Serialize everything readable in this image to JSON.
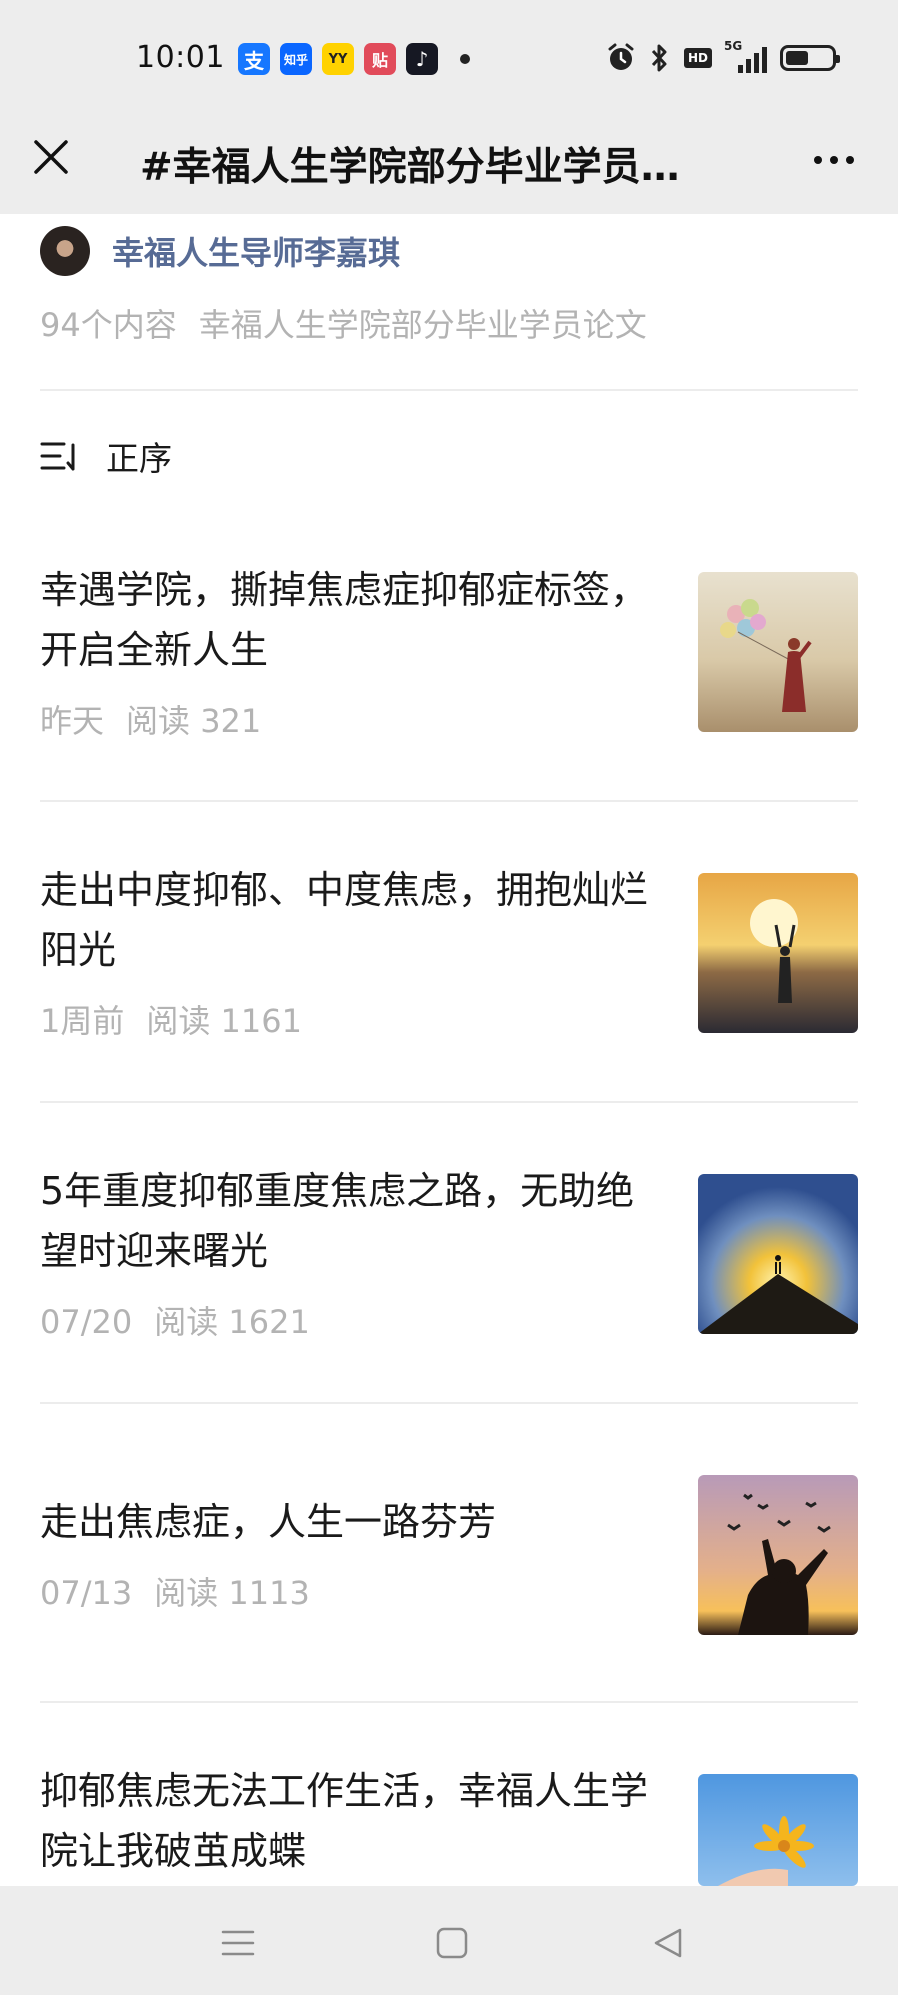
{
  "status_bar": {
    "time": "10:01",
    "notification_apps": [
      {
        "icon": "alipay-icon",
        "glyph": "支",
        "color": "#1677ff"
      },
      {
        "icon": "zhihu-icon",
        "glyph": "知乎",
        "color": "#0a66ff"
      },
      {
        "icon": "yy-icon",
        "glyph": "YY",
        "color": "#ffd200"
      },
      {
        "icon": "tieba-icon",
        "glyph": "贴",
        "color": "#e14b5a"
      },
      {
        "icon": "tiktok-icon",
        "glyph": "♪",
        "color": "#161823"
      }
    ],
    "system_icons": [
      "alarm-icon",
      "bluetooth-icon",
      "hd-icon",
      "5g-signal-icon",
      "battery-icon"
    ],
    "hd_label": "HD",
    "network_label": "5G",
    "battery_level": 0.45
  },
  "title_bar": {
    "title": "#幸福人生学院部分毕业学员…"
  },
  "album": {
    "author": "幸福人生导师李嘉琪",
    "count": "94个内容",
    "name": "幸福人生学院部分毕业学员论文"
  },
  "sort": {
    "label": "正序"
  },
  "articles": [
    {
      "title": "幸遇学院，撕掉焦虑症抑郁症标签，开启全新人生",
      "date": "昨天",
      "reads": "阅读 321",
      "thumbnail": "woman-with-balloons-image"
    },
    {
      "title": "走出中度抑郁、中度焦虑，拥抱灿烂阳光",
      "date": "1周前",
      "reads": "阅读 1161",
      "thumbnail": "woman-arms-raised-sunset-sea-image"
    },
    {
      "title": "5年重度抑郁重度焦虑之路，无助绝望时迎来曙光",
      "date": "07/20",
      "reads": "阅读 1621",
      "thumbnail": "person-on-mountain-sunrise-image"
    },
    {
      "title": "走出焦虑症，人生一路芬芳",
      "date": "07/13",
      "reads": "阅读 1113",
      "thumbnail": "silhouette-with-birds-image"
    },
    {
      "title": "抑郁焦虑无法工作生活，幸福人生学院让我破茧成蝶",
      "date": "",
      "reads": "",
      "thumbnail": "hand-holding-flower-image"
    }
  ],
  "colors": {
    "author_link": "#576b95",
    "meta_gray": "#b3b3b3",
    "bar_bg": "#ededed"
  }
}
